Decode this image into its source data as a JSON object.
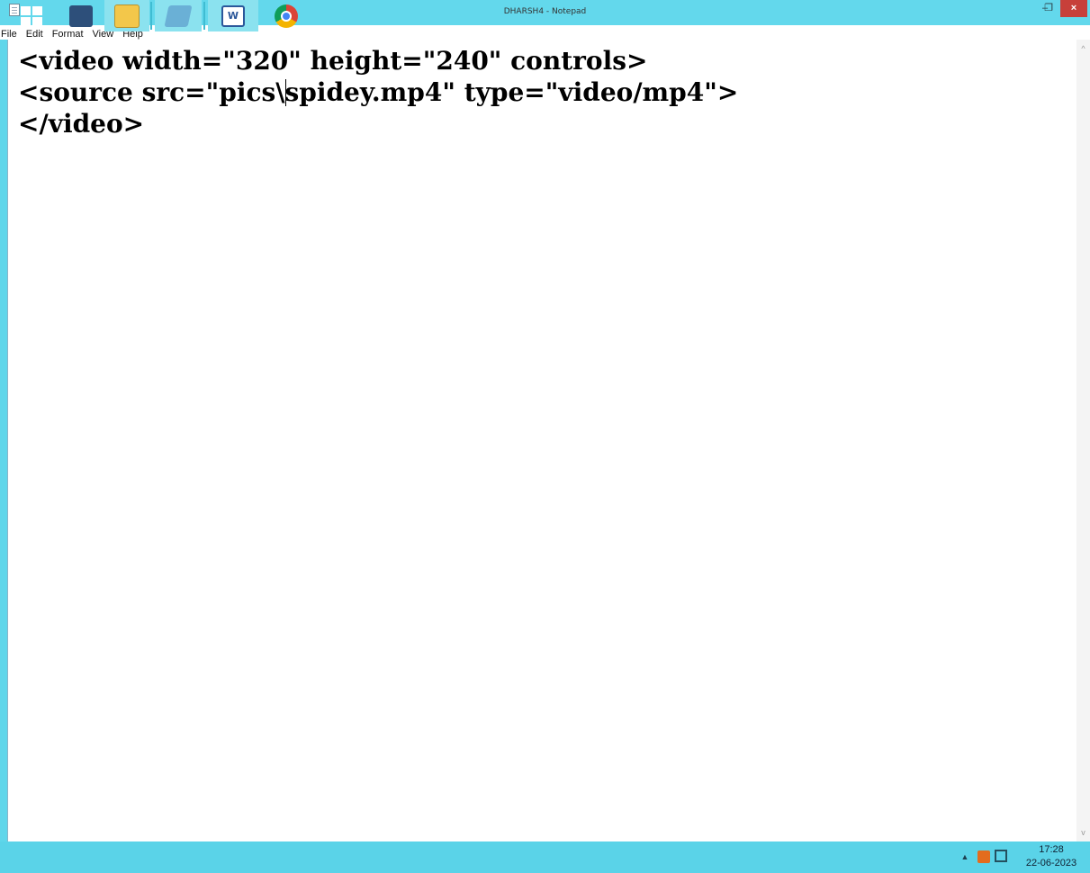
{
  "window": {
    "title": "DHARSH4 - Notepad",
    "controls": {
      "minimize": "–",
      "restore": "❐",
      "close": "×"
    }
  },
  "menu": [
    "File",
    "Edit",
    "Format",
    "View",
    "Help"
  ],
  "editor": {
    "lines": [
      "<video width=\"320\" height=\"240\" controls>",
      "<source src=\"pics\\",
      "spidey.mp4\" type=\"video/mp4\">",
      "</video>"
    ]
  },
  "taskbar": {
    "apps": [
      "start-icon",
      "computer-icon",
      "file-explorer-icon",
      "notepad-icon",
      "word-icon",
      "chrome-icon"
    ],
    "word_glyph": "W"
  },
  "tray": {
    "time": "17:28",
    "date": "22-06-2023",
    "arrow": "▲"
  }
}
